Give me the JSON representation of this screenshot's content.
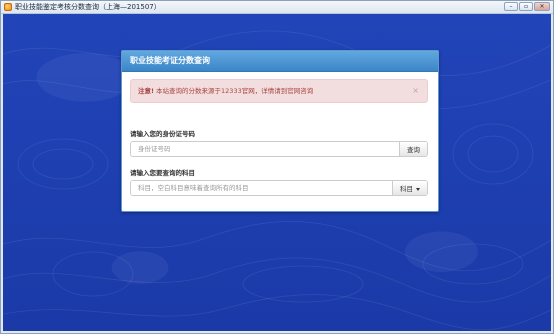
{
  "window": {
    "title": "职业技能鉴定考核分数查询（上海—201507）",
    "controls": {
      "minimize": "▭",
      "restore": "▭",
      "close": "✕"
    }
  },
  "panel": {
    "heading": "职业技能考证分数查询",
    "alert": {
      "strong": "注意!",
      "text": " 本站查询的分数来源于12333官网，详情请到官网咨询",
      "close": "×"
    },
    "id_field": {
      "label": "请输入您的身份证号码",
      "placeholder": "身份证号码",
      "value": "",
      "button": "查询"
    },
    "subject_field": {
      "label": "请输入您要查询的科目",
      "placeholder": "科目，空白科目意味着查询所有的科目",
      "value": "",
      "button": "科目"
    }
  },
  "colors": {
    "background": "#1d3fb2",
    "panel_header": "#3b86c7",
    "alert_bg": "#f2dede",
    "alert_text": "#a94442"
  }
}
